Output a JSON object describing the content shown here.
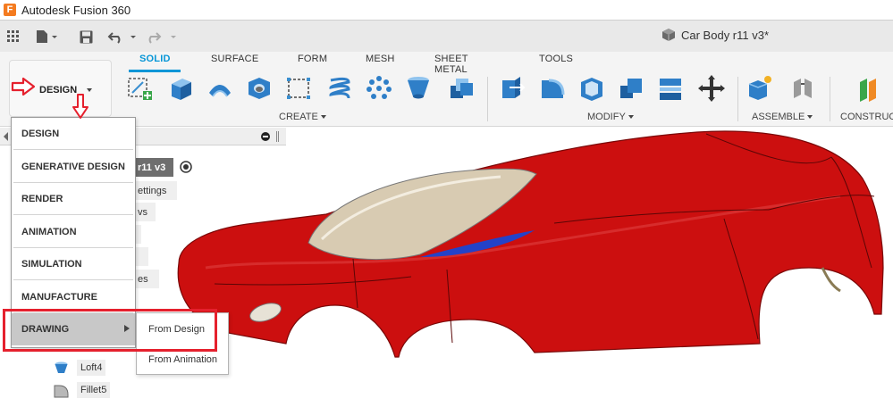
{
  "titlebar": {
    "app_logo": "F",
    "title": "Autodesk Fusion 360"
  },
  "document": {
    "name": "Car Body r11 v3*",
    "icon": "cube-icon"
  },
  "workspace": {
    "current": "DESIGN"
  },
  "ribbon": {
    "tabs": [
      "SOLID",
      "SURFACE",
      "FORM",
      "MESH",
      "SHEET METAL",
      "TOOLS"
    ],
    "active_tab": "SOLID",
    "groups": {
      "create": "CREATE",
      "modify": "MODIFY",
      "assemble": "ASSEMBLE",
      "construct": "CONSTRUCT"
    }
  },
  "workspace_menu": {
    "items": [
      "DESIGN",
      "GENERATIVE DESIGN",
      "RENDER",
      "ANIMATION",
      "SIMULATION",
      "MANUFACTURE",
      "DRAWING"
    ],
    "highlighted": "DRAWING"
  },
  "drawing_submenu": {
    "items": [
      "From Design",
      "From Animation"
    ]
  },
  "browser": {
    "root_label": "r11 v3",
    "partial_nodes": [
      "ettings",
      "vs",
      "es"
    ],
    "features": [
      {
        "label": "Loft4",
        "icon": "loft-icon"
      },
      {
        "label": "Fillet5",
        "icon": "fillet-icon"
      }
    ]
  },
  "colors": {
    "accent": "#0696d7",
    "annotation": "#e5202d",
    "car_body": "#cc0f0f",
    "canopy": "#d8cbb2"
  }
}
